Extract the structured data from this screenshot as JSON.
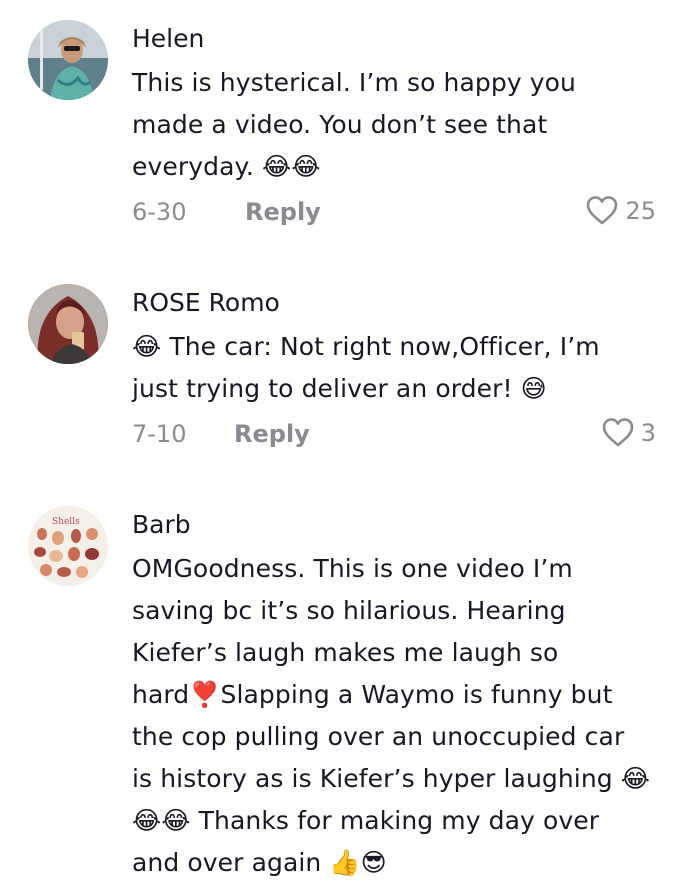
{
  "comments": [
    {
      "username": "Helen",
      "text": "This is hysterical. I’m so happy you made a video. You don’t see that everyday. 😂😂",
      "date": "6-30",
      "reply_label": "Reply",
      "likes": "25",
      "avatar": "avatar-photo-woman-sunglasses"
    },
    {
      "username": "ROSE Romo",
      "text": "😂 The car: Not right now,Officer, I’m just trying to deliver an order! 😅",
      "date": "7-10",
      "reply_label": "Reply",
      "likes": "3",
      "avatar": "avatar-photo-woman-selfie"
    },
    {
      "username": "Barb",
      "text": "OMGoodness. This is one video I’m saving bc it’s so hilarious. Hearing Kiefer’s laugh makes me laugh so hard❣️Slapping a Waymo is funny but the cop pulling over an unoccupied car is history as is Kiefer’s hyper laughing 😂😂😂 Thanks for making my day over and over again 👍😎",
      "avatar": "avatar-shells-chart",
      "avatar_label": "Shells"
    }
  ],
  "icons": {
    "like": "heart-outline-icon"
  },
  "colors": {
    "text": "#161823",
    "muted": "#8a8b91"
  }
}
